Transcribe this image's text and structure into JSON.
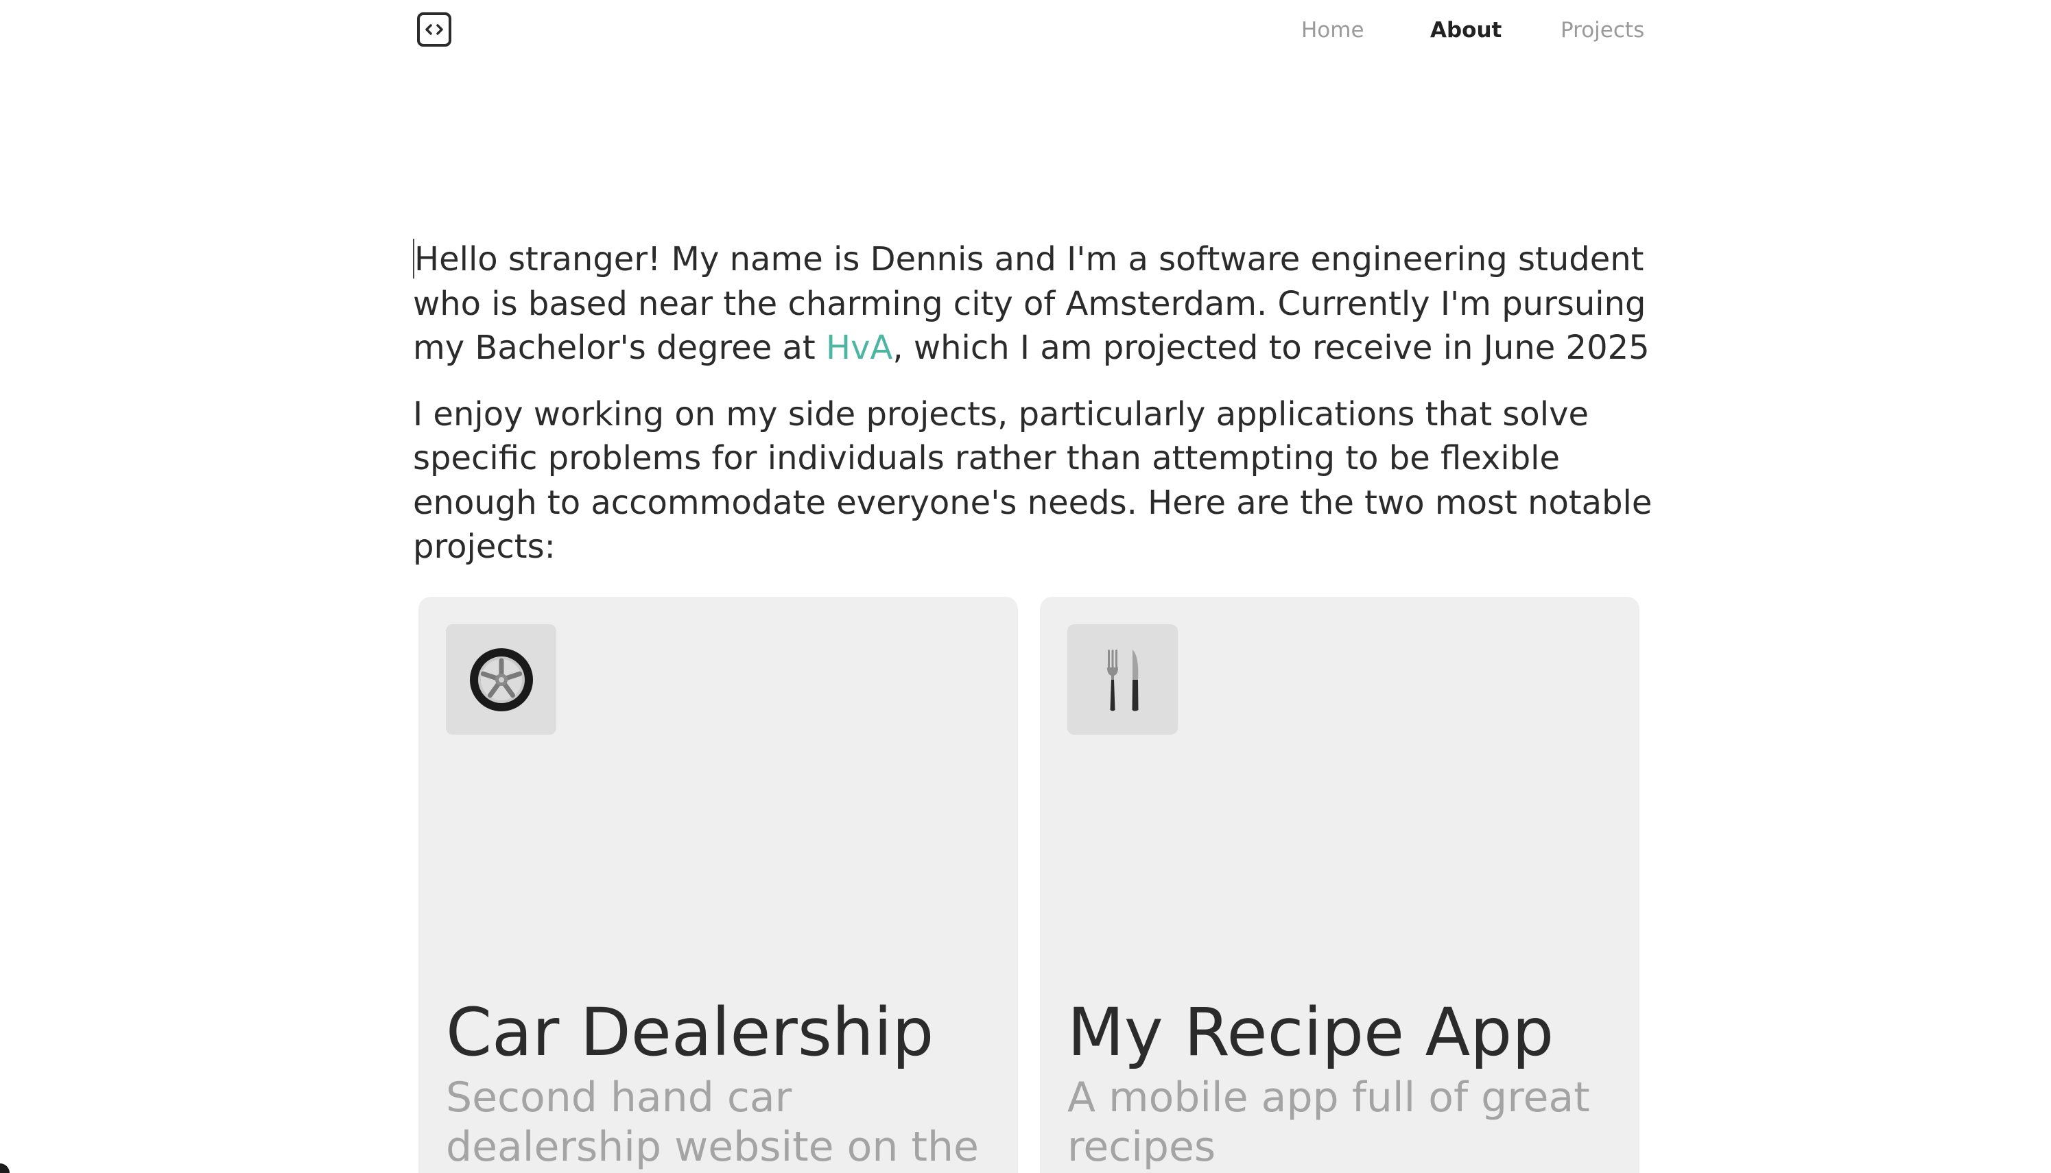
{
  "nav": {
    "logo_icon": "code-brackets-icon",
    "items": [
      {
        "label": "Home",
        "active": false
      },
      {
        "label": "About",
        "active": true
      },
      {
        "label": "Projects",
        "active": false
      }
    ]
  },
  "intro": {
    "p1_before_link": "Hello stranger! My name is Dennis and I'm a software engineering student who is based near the charming city of Amsterdam. Currently I'm pursuing my Bachelor's degree at ",
    "p1_link": "HvA",
    "p1_after_link": ", which I am projected to receive in June 2025",
    "p2": "I enjoy working on my side projects, particularly applications that solve specific problems for individuals rather than attempting to be flexible enough to accommodate everyone's needs. Here are the two most notable projects:"
  },
  "projects": [
    {
      "icon": "car-wheel-icon",
      "title": "Car Dealership",
      "subtitle": "Second hand car dealership website on the blockchain"
    },
    {
      "icon": "fork-and-knife-icon",
      "title": "My Recipe App",
      "subtitle": "A mobile app full of great recipes"
    }
  ],
  "colors": {
    "accent": "#4db6a3",
    "text": "#2b2b2b",
    "muted": "#9a9a9a",
    "card_bg": "#efefef"
  }
}
